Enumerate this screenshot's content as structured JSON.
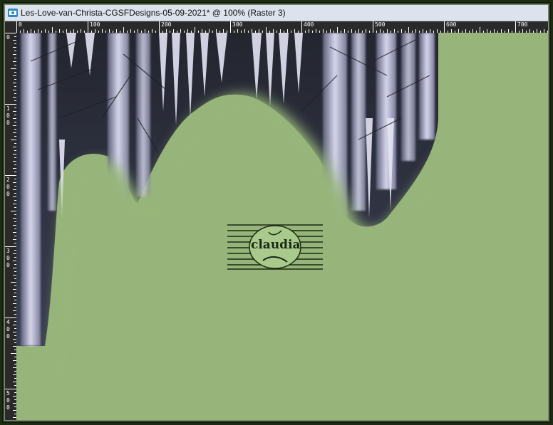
{
  "window": {
    "title": "Les-Love-van-Christa-CGSFDesigns-05-09-2021* @ 100% (Raster 3)",
    "icon": "paintshop-document-icon"
  },
  "rulers": {
    "horizontal": [
      "0",
      "100",
      "200",
      "300",
      "400",
      "500",
      "600",
      "700"
    ],
    "vertical": [
      "0",
      "100",
      "200",
      "300",
      "400",
      "500"
    ]
  },
  "canvas": {
    "background_color": "#97b57a",
    "layer": "Raster 3",
    "zoom": "100%",
    "watermark_text": "claudia"
  }
}
